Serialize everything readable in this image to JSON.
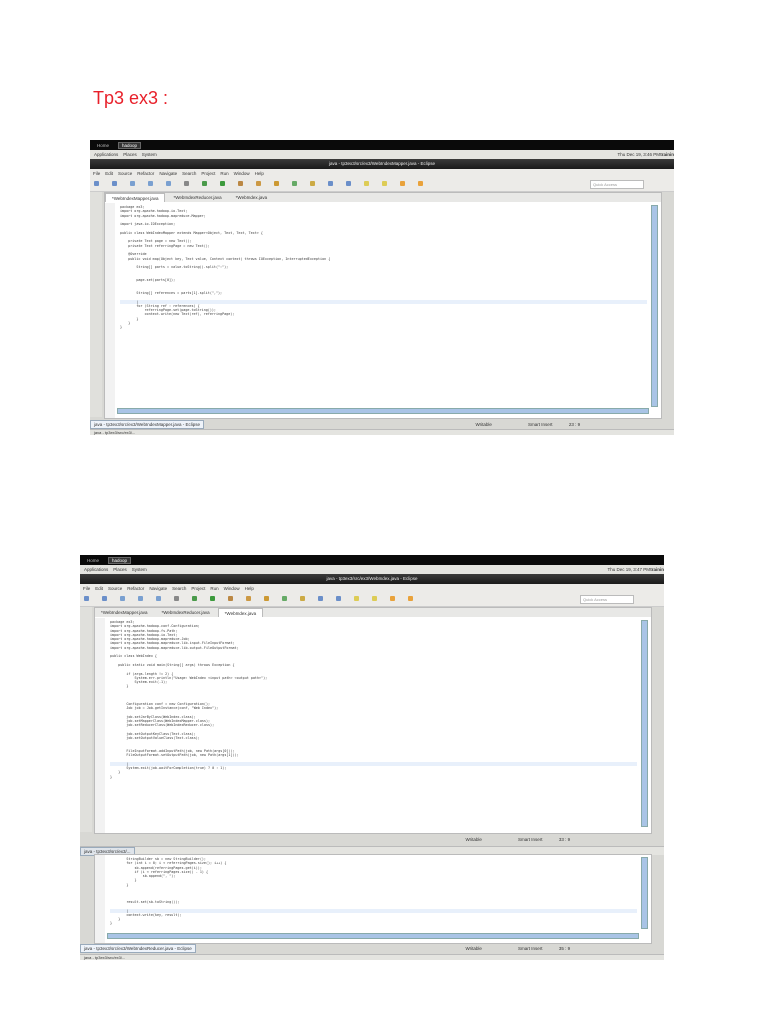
{
  "heading": "Tp3 ex3 :",
  "desktop": {
    "tabs": [
      "Home",
      "hadoop"
    ],
    "panel_menu": [
      "Applications",
      "Places",
      "System"
    ],
    "user": "trainin"
  },
  "menu": [
    "File",
    "Edit",
    "Source",
    "Refactor",
    "Navigate",
    "Search",
    "Project",
    "Run",
    "Window",
    "Help"
  ],
  "quick_access_placeholder": "Quick Access",
  "editor_tabs": [
    "*WebIndexMapper.java",
    "*WebIndexReducer.java",
    "*WebIndex.java"
  ],
  "screenshot1": {
    "clock": "Thu Dec 19, 3:46 PM",
    "window_title": "java - tp3ex3/src/ex3/WebIndexMapper.java - Eclipse",
    "status_path": "java - tp3ex3/src/ex3/WebIndexMapper.java - Eclipse",
    "writable": "Writable",
    "insert_mode": "Smart Insert",
    "position": "23 : 9",
    "taskbar_item": "java - tp3ex3/src/ex3/...",
    "code": [
      "package ex3;",
      "import org.apache.hadoop.io.Text;",
      "import org.apache.hadoop.mapreduce.Mapper;",
      "",
      "import java.io.IOException;",
      "",
      "public class WebIndexMapper extends Mapper<Object, Text, Text, Text> {",
      "",
      "    private Text page = new Text();",
      "    private Text referringPage = new Text();",
      "",
      "    @Override",
      "    public void map(Object key, Text value, Context context) throws IOException, InterruptedException {",
      "",
      "        String[] parts = value.toString().split(\":\");",
      "",
      "",
      "        page.set(parts[0]);",
      "",
      "",
      "        String[] references = parts[1].split(\",\");",
      "",
      "        |",
      "        for (String ref : references) {",
      "            referringPage.set(page.toString());",
      "            context.write(new Text(ref), referringPage);",
      "        }",
      "    }",
      "}"
    ],
    "cursor_line": 22
  },
  "screenshot2": {
    "clock": "Thu Dec 19, 3:47 PM",
    "window_title": "java - tp3ex3/src/ex3/WebIndex.java - Eclipse",
    "writable": "Writable",
    "insert_mode": "Smart Insert",
    "position": "33 : 9",
    "code": [
      "package ex3;",
      "import org.apache.hadoop.conf.Configuration;",
      "import org.apache.hadoop.fs.Path;",
      "import org.apache.hadoop.io.Text;",
      "import org.apache.hadoop.mapreduce.Job;",
      "import org.apache.hadoop.mapreduce.lib.input.FileInputFormat;",
      "import org.apache.hadoop.mapreduce.lib.output.FileOutputFormat;",
      "",
      "public class WebIndex {",
      "",
      "    public static void main(String[] args) throws Exception {",
      "",
      "        if (args.length != 2) {",
      "            System.err.println(\"Usage: WebIndex <input path> <output path>\");",
      "            System.exit(-1);",
      "        }",
      "",
      "",
      "",
      "        Configuration conf = new Configuration();",
      "        Job job = Job.getInstance(conf, \"Web Index\");",
      "",
      "        job.setJarByClass(WebIndex.class);",
      "        job.setMapperClass(WebIndexMapper.class);",
      "        job.setReducerClass(WebIndexReducer.class);",
      "",
      "        job.setOutputKeyClass(Text.class);",
      "        job.setOutputValueClass(Text.class);",
      "",
      "",
      "        FileInputFormat.addInputPath(job, new Path(args[0]));",
      "        FileOutputFormat.setOutputPath(job, new Path(args[1]));",
      "",
      "        |",
      "        System.exit(job.waitForCompletion(true) ? 0 : 1);",
      "    }",
      "}"
    ],
    "cursor_line": 33
  },
  "screenshot3": {
    "tab": "java - tp3ex3/src/ex3/...",
    "status_path": "java - tp3ex3/src/ex3/WebIndexReducer.java - Eclipse",
    "writable": "Writable",
    "insert_mode": "Smart Insert",
    "position": "35 : 9",
    "taskbar_item": "java - tp3ex3/src/ex3/...",
    "code": [
      "        StringBuilder sb = new StringBuilder();",
      "        for (int i = 0; i < referringPages.size(); i++) {",
      "            sb.append(referringPages.get(i));",
      "            if (i < referringPages.size() - 1) {",
      "                sb.append(\", \");",
      "            }",
      "        }",
      "",
      "",
      "",
      "        result.set(sb.toString());",
      "",
      "        |",
      "        context.write(key, result);",
      "    }",
      "}"
    ],
    "cursor_line": 12
  }
}
